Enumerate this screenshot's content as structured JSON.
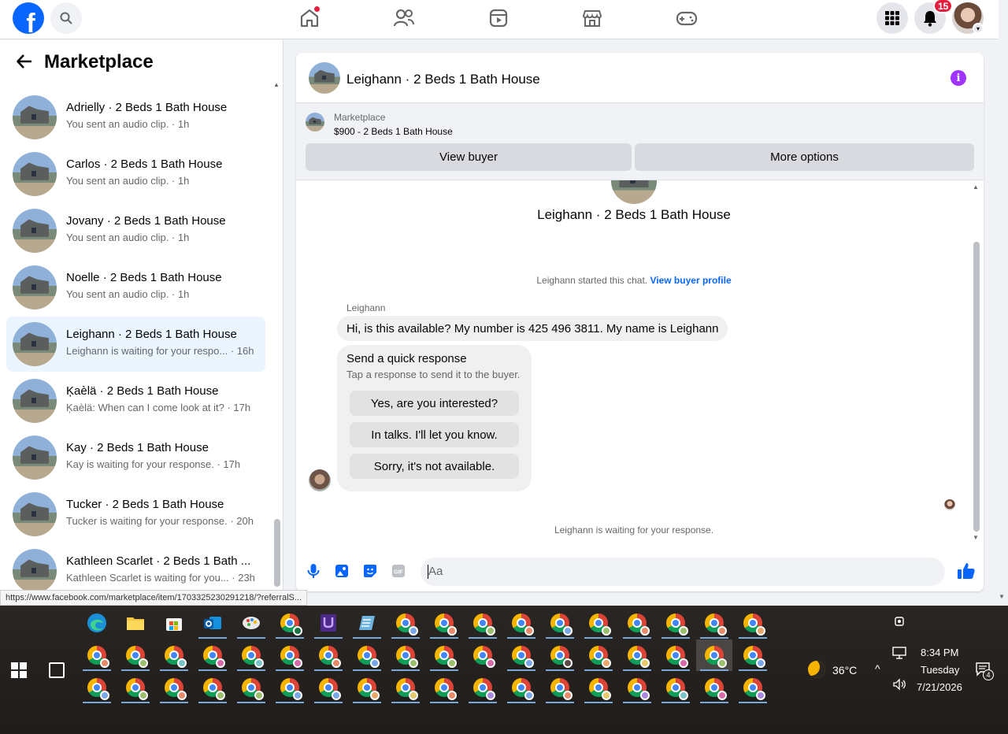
{
  "sidebar": {
    "title": "Marketplace",
    "conversations": [
      {
        "name": "Adrielly · 2 Beds 1 Bath House",
        "snippet": "You sent an audio clip. · 1h"
      },
      {
        "name": "Carlos · 2 Beds 1 Bath House",
        "snippet": "You sent an audio clip. · 1h"
      },
      {
        "name": "Jovany · 2 Beds 1 Bath House",
        "snippet": "You sent an audio clip. · 1h"
      },
      {
        "name": "Noelle · 2 Beds 1 Bath House",
        "snippet": "You sent an audio clip. · 1h"
      },
      {
        "name": "Leighann · 2 Beds 1 Bath House",
        "snippet": "Leighann is waiting for your respo... · 16h"
      },
      {
        "name": "Ķaèlä · 2 Beds 1 Bath House",
        "snippet": "Ķaèlä: When can I come look at it? · 17h"
      },
      {
        "name": "Kay · 2 Beds 1 Bath House",
        "snippet": "Kay is waiting for your response. · 17h"
      },
      {
        "name": "Tucker · 2 Beds 1 Bath House",
        "snippet": "Tucker is waiting for your response. · 20h"
      },
      {
        "name": "Kathleen Scarlet · 2 Beds 1 Bath ...",
        "snippet": "Kathleen Scarlet is waiting for you... · 23h"
      }
    ]
  },
  "topbar": {
    "notification_count": "15"
  },
  "chat": {
    "title": "Leighann · 2 Beds 1 Bath House",
    "listing_label": "Marketplace",
    "listing_price": "$900 - 2 Beds 1 Bath House",
    "view_buyer": "View buyer",
    "more_options": "More options",
    "system_text": "Leighann started this chat.",
    "system_link": "View buyer profile",
    "sender": "Leighann",
    "message": "Hi, is this available? My number is 425 496 3811. My name is Leighann",
    "quick_title": "Send a quick response",
    "quick_sub": "Tap a response to send it to the buyer.",
    "quick_responses": [
      "Yes, are you interested?",
      "In talks. I'll let you know.",
      "Sorry, it's not available."
    ],
    "waiting": "Leighann is waiting for your response.",
    "composer_placeholder": "Aa"
  },
  "status_url": "https://www.facebook.com/marketplace/item/1703325230291218/?referralS...",
  "taskbar": {
    "temperature": "36°C",
    "time": "8:34 PM",
    "day": "Tuesday",
    "date": "7/21/2026",
    "notif_count": "4"
  },
  "colors": {
    "brand": "#0866ff",
    "active_row": "#ebf5ff",
    "info": "#a033ff"
  }
}
